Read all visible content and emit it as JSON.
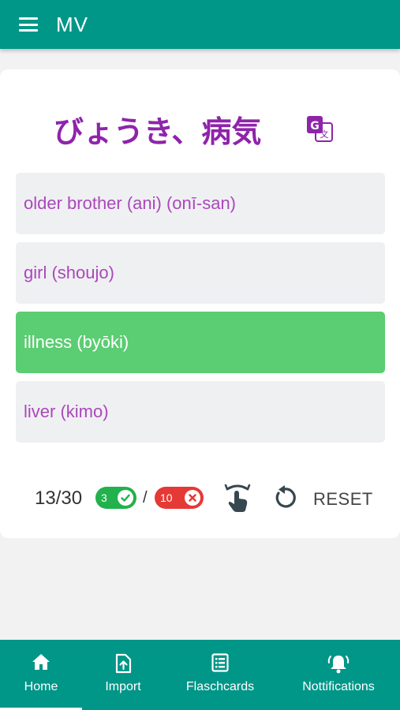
{
  "app_bar": {
    "title": "MV",
    "menu_icon": "hamburger-menu-icon"
  },
  "question": {
    "text": "びょうき、病気",
    "translate_icon": "google-translate-icon"
  },
  "options": [
    {
      "label": "older brother (ani) (onī-san)",
      "state": "default"
    },
    {
      "label": "girl (shoujo)",
      "state": "default"
    },
    {
      "label": "illness (byōki)",
      "state": "correct"
    },
    {
      "label": "liver (kimo)",
      "state": "default"
    }
  ],
  "stats": {
    "progress": "13/30",
    "correct_count": "3",
    "separator": "/",
    "wrong_count": "10",
    "reset_label": "RESET"
  },
  "bottom_nav": {
    "active": "Home",
    "items": [
      {
        "label": "Home",
        "icon": "home-icon"
      },
      {
        "label": "Import",
        "icon": "file-import-icon"
      },
      {
        "label": "Flaschcards",
        "icon": "list-card-icon"
      },
      {
        "label": "Nottifications",
        "icon": "bell-icon"
      }
    ]
  },
  "colors": {
    "primary": "#009688",
    "accent_text": "#8e24aa",
    "correct": "#5bcd72",
    "correct_badge": "#22b14c",
    "wrong_badge": "#e53935"
  }
}
